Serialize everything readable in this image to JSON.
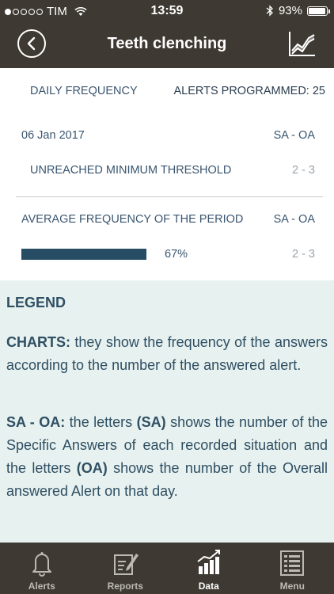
{
  "status_bar": {
    "carrier": "TIM",
    "time": "13:59",
    "battery": "93%"
  },
  "nav": {
    "title": "Teeth clenching",
    "back_icon": "chevron-left-icon",
    "chart_icon": "area-chart-icon"
  },
  "summary": {
    "daily_frequency_label": "DAILY FREQUENCY",
    "alerts_programmed_label": "ALERTS PROGRAMMED: 25",
    "date": "06 Jan 2017",
    "date_col": "SA - OA",
    "threshold_label": "UNREACHED MINIMUM THRESHOLD",
    "threshold_value": "2 - 3",
    "average_label": "AVERAGE FREQUENCY OF THE PERIOD",
    "average_col": "SA - OA",
    "average_percent_text": "67%",
    "average_fraction": 0.67,
    "average_value": "2 - 3",
    "bar_color": "#264d63"
  },
  "legend": {
    "heading": "LEGEND",
    "charts_term": "CHARTS:",
    "charts_text": " they show the frequency of the answers according to the number of the answered alert.",
    "sa_oa_term": "SA - OA:",
    "sa_text_1": " the letters ",
    "sa_term": "(SA)",
    "sa_text_2": " shows the number of the Specific Answers of each recorded situation and the letters ",
    "oa_term": "(OA)",
    "sa_text_3": " shows the number of the Overall answered Alert on that day."
  },
  "tabs": [
    {
      "label": "Alerts",
      "icon": "bell-icon",
      "active": false
    },
    {
      "label": "Reports",
      "icon": "edit-report-icon",
      "active": false
    },
    {
      "label": "Data",
      "icon": "bar-chart-icon",
      "active": true
    },
    {
      "label": "Menu",
      "icon": "list-icon",
      "active": false
    }
  ],
  "colors": {
    "header_bg": "#3e3a33",
    "text_blue": "#3a5670",
    "legend_bg": "#e7f1ef"
  }
}
